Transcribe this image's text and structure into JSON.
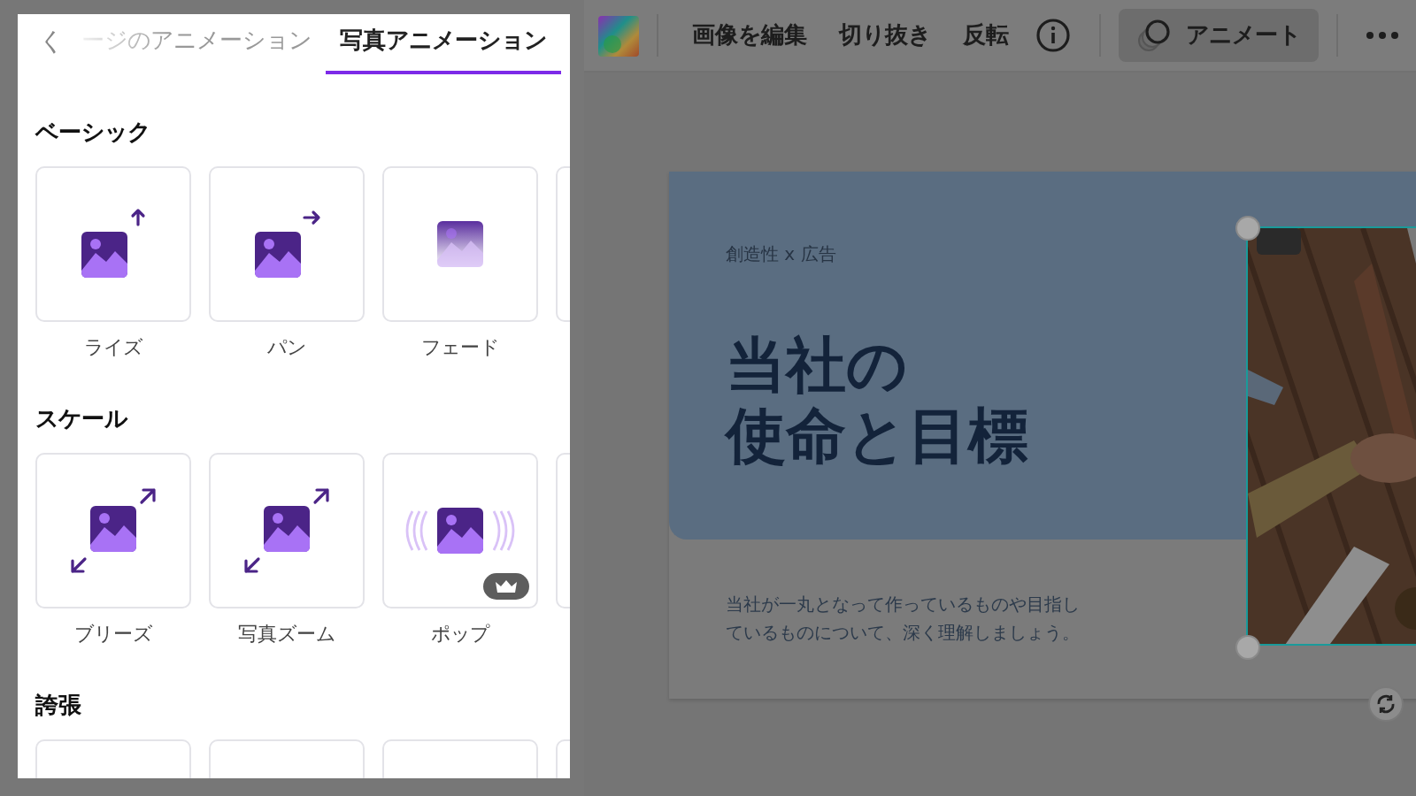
{
  "panel": {
    "back": "く",
    "tabs": [
      {
        "label": "ージのアニメーション",
        "selected": false
      },
      {
        "label": "写真アニメーション",
        "selected": true
      }
    ],
    "sections": [
      {
        "title": "ベーシック",
        "items": [
          {
            "label": "ライズ",
            "kind": "rise",
            "premium": false
          },
          {
            "label": "パン",
            "kind": "pan",
            "premium": false
          },
          {
            "label": "フェード",
            "kind": "fade",
            "premium": false
          },
          {
            "kind": "blank"
          }
        ]
      },
      {
        "title": "スケール",
        "items": [
          {
            "label": "ブリーズ",
            "kind": "breathe",
            "premium": false
          },
          {
            "label": "写真ズーム",
            "kind": "zoom",
            "premium": false
          },
          {
            "label": "ポップ",
            "kind": "pop",
            "premium": true
          },
          {
            "kind": "blank"
          }
        ]
      },
      {
        "title": "誇張",
        "items": [
          {
            "kind": "blank"
          },
          {
            "kind": "blank"
          },
          {
            "kind": "blank"
          },
          {
            "kind": "blank"
          }
        ]
      }
    ]
  },
  "toolbar": {
    "items": [
      {
        "kind": "swatch"
      },
      {
        "kind": "divider"
      },
      {
        "kind": "text",
        "label": "画像を編集"
      },
      {
        "kind": "text",
        "label": "切り抜き"
      },
      {
        "kind": "text",
        "label": "反転"
      },
      {
        "kind": "info"
      },
      {
        "kind": "divider"
      },
      {
        "kind": "animate",
        "label": "アニメート",
        "selected": true
      },
      {
        "kind": "divider"
      },
      {
        "kind": "more"
      }
    ]
  },
  "slide": {
    "eyebrow": "創造性 x 広告",
    "title_lines": [
      "当社の",
      "使命と目標"
    ],
    "body": "当社が一丸となって作っているものや目指しているものについて、深く理解しましょう。",
    "image": {
      "kind": "picture",
      "selected": true
    }
  }
}
